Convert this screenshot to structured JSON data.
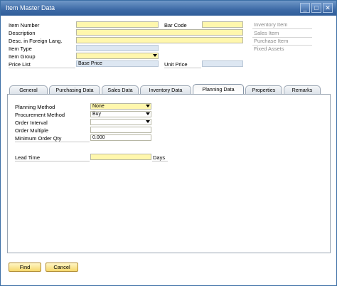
{
  "window": {
    "title": "Item Master Data"
  },
  "titlebar_buttons": {
    "minimize": "_",
    "maximize": "□",
    "close": "✕"
  },
  "header": {
    "item_number_label": "Item Number",
    "bar_code_label": "Bar Code",
    "description_label": "Description",
    "desc_foreign_label": "Desc. in Foreign Lang.",
    "item_type_label": "Item Type",
    "item_group_label": "Item Group",
    "price_list_label": "Price List",
    "price_list_value": "Base Price",
    "unit_price_label": "Unit Price"
  },
  "item_kinds": [
    "Inventory Item",
    "Sales Item",
    "Purchase Item",
    "Fixed Assets"
  ],
  "tabs": [
    {
      "label": "General"
    },
    {
      "label": "Purchasing Data"
    },
    {
      "label": "Sales Data"
    },
    {
      "label": "Inventory Data"
    },
    {
      "label": "Planning Data"
    },
    {
      "label": "Properties"
    },
    {
      "label": "Remarks"
    }
  ],
  "planning": {
    "planning_method_label": "Planning Method",
    "planning_method_value": "None",
    "procurement_method_label": "Procurement Method",
    "procurement_method_value": "Buy",
    "order_interval_label": "Order Interval",
    "order_multiple_label": "Order Multiple",
    "min_order_qty_label": "Minimum Order Qty",
    "min_order_qty_value": "0.000",
    "lead_time_label": "Lead Time",
    "lead_time_unit": "Days"
  },
  "buttons": {
    "find": "Find",
    "cancel": "Cancel"
  }
}
